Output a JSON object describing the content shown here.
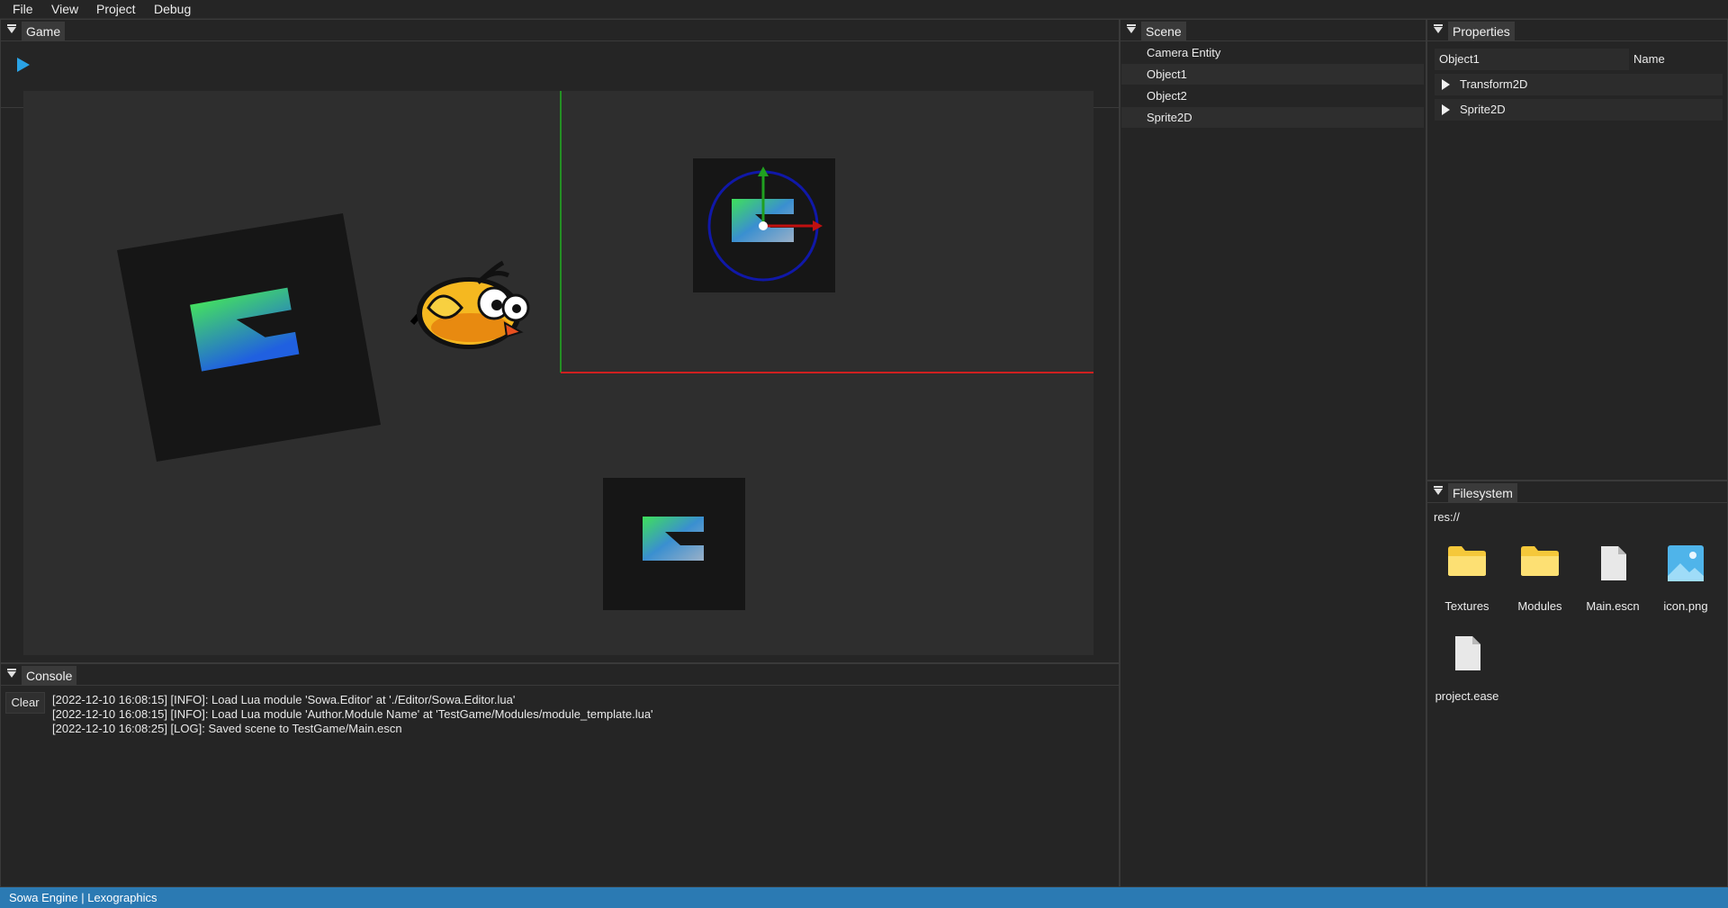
{
  "menubar": {
    "items": [
      {
        "label": "File"
      },
      {
        "label": "View"
      },
      {
        "label": "Project"
      },
      {
        "label": "Debug"
      }
    ]
  },
  "game": {
    "tab": "Game"
  },
  "scene": {
    "tab": "Scene",
    "entities": [
      "Camera Entity",
      "Object1",
      "Object2",
      "Sprite2D"
    ]
  },
  "properties": {
    "tab": "Properties",
    "name_value": "Object1",
    "name_label": "Name",
    "components": [
      "Transform2D",
      "Sprite2D"
    ]
  },
  "filesystem": {
    "tab": "Filesystem",
    "path": "res://",
    "items": [
      {
        "name": "Textures",
        "icon": "folder-icon"
      },
      {
        "name": "Modules",
        "icon": "folder-icon"
      },
      {
        "name": "Main.escn",
        "icon": "file-icon"
      },
      {
        "name": "icon.png",
        "icon": "image-file-icon"
      },
      {
        "name": "project.ease",
        "icon": "file-icon"
      }
    ]
  },
  "console": {
    "tab": "Console",
    "clear_label": "Clear",
    "lines": [
      "[2022-12-10 16:08:15] [INFO]: Load Lua module 'Sowa.Editor' at './Editor/Sowa.Editor.lua'",
      "[2022-12-10 16:08:15] [INFO]: Load Lua module 'Author.Module Name' at 'TestGame/Modules/module_template.lua'",
      "[2022-12-10 16:08:25] [LOG]: Saved scene to TestGame/Main.escn"
    ]
  },
  "statusbar": {
    "text": "Sowa Engine | Lexographics"
  },
  "colors": {
    "accent": "#2aa3e6",
    "statusbar": "#2b7ab3",
    "axis_x": "#d02020",
    "axis_y": "#20b020",
    "gizmo_ring": "#1018a8"
  }
}
